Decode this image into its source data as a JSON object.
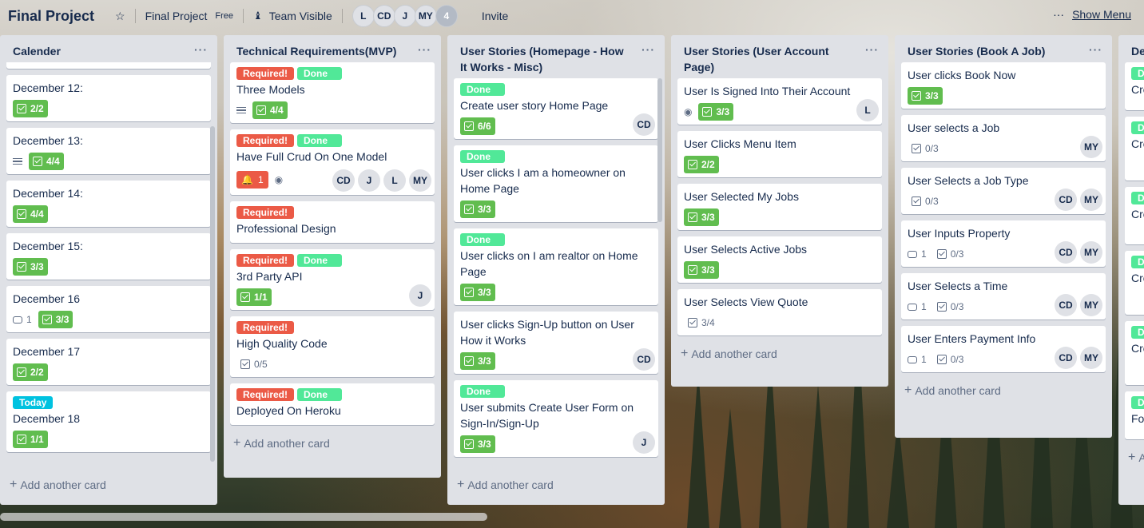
{
  "header": {
    "board_title": "Final Project",
    "team_name": "Final Project",
    "team_plan": "Free",
    "visibility": "Team Visible",
    "members": [
      "L",
      "CD",
      "J",
      "MY"
    ],
    "member_count": "4",
    "invite_label": "Invite",
    "show_menu_label": "Show Menu"
  },
  "lists": [
    {
      "title": "Calender",
      "cards": [
        {
          "title": "December 12:",
          "checklist": "2/2"
        },
        {
          "title": "December 13:",
          "checklist": "4/4"
        },
        {
          "title": "December 14:",
          "checklist": "4/4"
        },
        {
          "title": "December 15:",
          "checklist": "3/3"
        },
        {
          "title": "December 16",
          "comments": "1",
          "checklist": "3/3"
        },
        {
          "title": "December 17",
          "checklist": "2/2"
        },
        {
          "label": "Today",
          "title": "December 18",
          "checklist": "1/1"
        }
      ],
      "add_card": "Add another card"
    },
    {
      "title": "Technical Requirements(MVP)",
      "cards": [
        {
          "label_required": "Required!",
          "label_done": "Done",
          "title": "Three Models",
          "checklist": "4/4"
        },
        {
          "label_required": "Required!",
          "label_done": "Done",
          "title": "Have Full Crud On One Model",
          "notifications": "1",
          "members": [
            "CD",
            "J",
            "L",
            "MY"
          ]
        },
        {
          "label_required": "Required!",
          "title": "Professional Design"
        },
        {
          "label_required": "Required!",
          "label_done": "Done",
          "title": "3rd Party API",
          "checklist": "1/1",
          "members": [
            "J"
          ]
        },
        {
          "label_required": "Required!",
          "title": "High Quality Code",
          "checklist": "0/5"
        },
        {
          "label_required": "Required!",
          "label_done": "Done",
          "title": "Deployed On Heroku"
        }
      ],
      "add_card": "Add another card"
    },
    {
      "title": "User Stories (Homepage - How It Works - Misc)",
      "cards": [
        {
          "label_done": "Done",
          "title": "Create user story Home Page",
          "checklist": "6/6",
          "members": [
            "CD"
          ]
        },
        {
          "label_done": "Done",
          "title": "User clicks I am a homeowner on Home Page",
          "checklist": "3/3"
        },
        {
          "label_done": "Done",
          "title": "User clicks on I am realtor on Home Page",
          "checklist": "3/3"
        },
        {
          "title": "User clicks Sign-Up button on User How it Works",
          "checklist": "3/3",
          "members": [
            "CD"
          ]
        },
        {
          "label_done": "Done",
          "title": "User submits Create User Form on Sign-In/Sign-Up",
          "checklist": "3/3",
          "members": [
            "J"
          ]
        }
      ],
      "add_card": "Add another card"
    },
    {
      "title": "User Stories (User Account Page)",
      "cards": [
        {
          "title": "User Is Signed Into Their Account",
          "checklist": "3/3",
          "members": [
            "L"
          ]
        },
        {
          "title": "User Clicks Menu Item",
          "checklist": "2/2"
        },
        {
          "title": "User Selected My Jobs",
          "checklist": "3/3"
        },
        {
          "title": "User Selects Active Jobs",
          "checklist": "3/3"
        },
        {
          "title": "User Selects View Quote",
          "checklist": "3/4"
        }
      ],
      "add_card": "Add another card"
    },
    {
      "title": "User Stories (Book A Job)",
      "cards": [
        {
          "title": "User clicks Book Now",
          "checklist": "3/3"
        },
        {
          "title": "User selects a Job",
          "checklist": "0/3",
          "members": [
            "MY"
          ]
        },
        {
          "title": "User Selects a Job Type",
          "checklist": "0/3",
          "members": [
            "CD",
            "MY"
          ]
        },
        {
          "title": "User Inputs Property",
          "comments": "1",
          "checklist": "0/3",
          "members": [
            "CD",
            "MY"
          ]
        },
        {
          "title": "User Selects a Time",
          "comments": "1",
          "checklist": "0/3",
          "members": [
            "CD",
            "MY"
          ]
        },
        {
          "title": "User Enters Payment Info",
          "comments": "1",
          "checklist": "0/3",
          "members": [
            "CD",
            "MY"
          ]
        }
      ],
      "add_card": "Add another card"
    },
    {
      "title": "De",
      "cards": [
        {
          "label_done": "D",
          "title": "Cre"
        },
        {
          "label_done": "D",
          "title": "Cre Re"
        },
        {
          "label_done": "D",
          "title": "Cre"
        },
        {
          "label_done": "D",
          "title": "Cre"
        },
        {
          "label_done": "D",
          "title": "Cre"
        },
        {
          "label_done": "D",
          "title": "Fo"
        }
      ],
      "add_card": "Ad"
    }
  ]
}
